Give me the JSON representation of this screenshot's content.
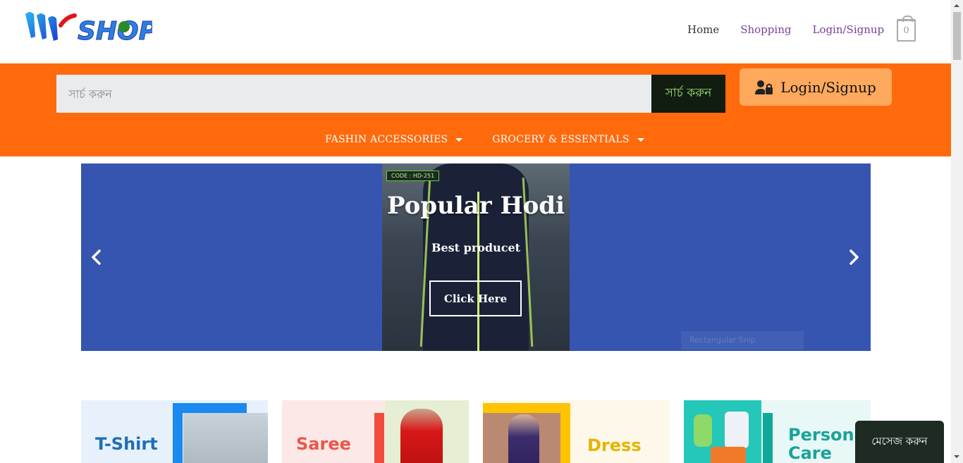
{
  "brand": {
    "logo_text": "MrSHOP"
  },
  "nav": {
    "home": "Home",
    "shopping": "Shopping",
    "login": "Login/Signup",
    "cart_count": "0"
  },
  "search": {
    "placeholder": "সার্চ করুন",
    "button": "সার্চ করুন"
  },
  "login_button": "Login/Signup",
  "categories": [
    "FASHIN ACCESSORIES",
    "GROCERY & ESSENTIALS"
  ],
  "slider": {
    "code_tag": "CODE : HD-251",
    "title": "Popular Hodi",
    "subtitle": "Best producet",
    "button": "Click Here",
    "ghost_text": "Rectangular Snip"
  },
  "category_cards": [
    {
      "label": "T-Shirt",
      "color": "#1f6fb5"
    },
    {
      "label": "Saree",
      "color": "#e8584a"
    },
    {
      "label": "Dress",
      "color": "#e5b400"
    },
    {
      "label": "Personal Care",
      "color": "#1aa39a"
    }
  ],
  "chat": "মেসেজ করুন",
  "colors": {
    "orange": "#ff6a0d",
    "slider_bg": "#3655b0",
    "login_btn": "#ffa95c",
    "search_btn": "#111d10",
    "link_purple": "#7a3e9d"
  }
}
